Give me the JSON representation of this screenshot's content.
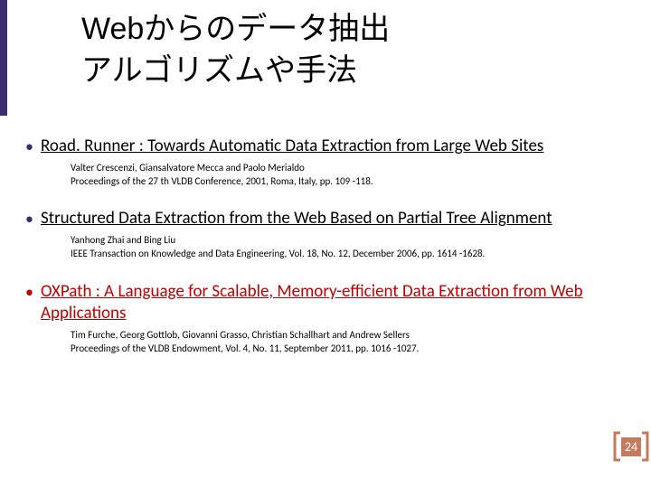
{
  "title_line1": "Webからのデータ抽出",
  "title_line2": "アルゴリズムや手法",
  "papers": [
    {
      "title": "Road. Runner : Towards Automatic Data Extraction from Large Web Sites",
      "authors": "Valter Crescenzi, Giansalvatore Mecca and Paolo Merialdo",
      "venue": "Proceedings of the 27 th VLDB Conference, 2001, Roma, Italy, pp. 109 -118."
    },
    {
      "title": "Structured Data Extraction from the Web Based on Partial Tree Alignment",
      "authors": "Yanhong Zhai and Bing Liu",
      "venue": "IEEE Transaction on Knowledge and Data Engineering, Vol. 18, No. 12, December 2006, pp. 1614 -1628."
    },
    {
      "title": "OXPath : A Language for Scalable, Memory-efficient Data Extraction from Web Applications",
      "authors": "Tim Furche, Georg Gottlob, Giovanni Grasso, Christian Schallhart and Andrew Sellers",
      "venue": "Proceedings of the VLDB Endowment, Vol. 4, No. 11, September 2011, pp. 1016 -1027."
    }
  ],
  "page_number": "24",
  "colors": {
    "accent": "#3b2e6e",
    "highlight": "#c00000",
    "badge": "#c47b5b"
  }
}
